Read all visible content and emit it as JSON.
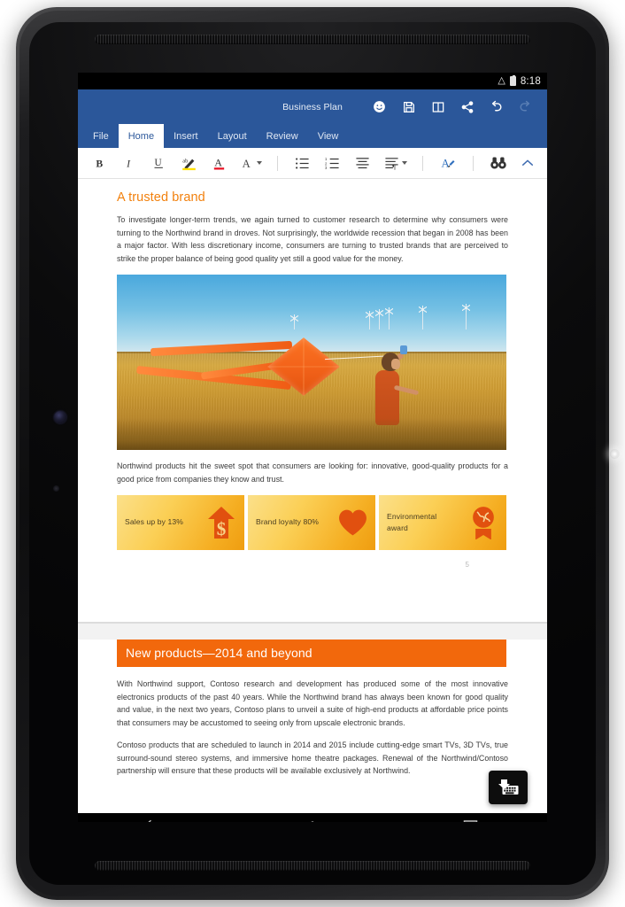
{
  "status_bar": {
    "wifi_icon": "wifi-icon",
    "battery_icon": "battery-full-icon",
    "clock": "8:18"
  },
  "title_bar": {
    "document_title": "Business Plan",
    "actions": [
      {
        "name": "smiley-feedback-icon",
        "label": "Smiley feedback"
      },
      {
        "name": "save-icon",
        "label": "Save"
      },
      {
        "name": "read-mode-icon",
        "label": "Read mode"
      },
      {
        "name": "share-icon",
        "label": "Share"
      },
      {
        "name": "undo-icon",
        "label": "Undo"
      },
      {
        "name": "redo-icon",
        "label": "Redo"
      }
    ]
  },
  "ribbon": {
    "tabs": [
      {
        "label": "File",
        "active": false
      },
      {
        "label": "Home",
        "active": true
      },
      {
        "label": "Insert",
        "active": false
      },
      {
        "label": "Layout",
        "active": false
      },
      {
        "label": "Review",
        "active": false
      },
      {
        "label": "View",
        "active": false
      }
    ],
    "toolbar": [
      {
        "name": "bold-icon",
        "label": "Bold"
      },
      {
        "name": "italic-icon",
        "label": "Italic"
      },
      {
        "name": "underline-icon",
        "label": "Underline"
      },
      {
        "name": "text-highlight-icon",
        "label": "Text Highlight Color"
      },
      {
        "name": "font-color-icon",
        "label": "Font Color"
      },
      {
        "name": "font-size-icon",
        "label": "Font Size"
      },
      {
        "name": "bullet-list-icon",
        "label": "Bulleted List"
      },
      {
        "name": "numbered-list-icon",
        "label": "Numbered List"
      },
      {
        "name": "align-icon",
        "label": "Alignment"
      },
      {
        "name": "paragraph-marks-icon",
        "label": "Paragraph Marks"
      },
      {
        "name": "format-painter-icon",
        "label": "Format Painter"
      },
      {
        "name": "find-icon",
        "label": "Find"
      }
    ],
    "collapse_icon": "chevron-up-icon"
  },
  "document": {
    "page5": {
      "heading": "A trusted brand",
      "paragraph1": "To investigate longer-term trends, we again turned to customer research to determine why consumers were turning to the Northwind brand in droves. Not surprisingly, the worldwide recession that began in 2008 has been a major factor. With less discretionary income, consumers are turning to trusted brands that are perceived to strike the proper balance of being good quality yet still a good value for the money.",
      "figure_alt": "Boy running through a wheat field flying an orange kite under a blue sky with wind turbines",
      "caption": "Northwind products hit the sweet spot that consumers are looking for: innovative, good-quality products for a good price from companies they know and trust.",
      "info_boxes": [
        {
          "label": "Sales up by 13%",
          "icon": "dollar-arrow-up-icon"
        },
        {
          "label": "Brand loyalty 80%",
          "icon": "heart-icon"
        },
        {
          "label": "Environmental award",
          "icon": "globe-award-icon"
        }
      ],
      "page_number": "5"
    },
    "page6": {
      "heading": "New products—2014 and beyond",
      "paragraph1": "With Northwind support, Contoso research and development has produced some of the most innovative electronics products of the past 40 years. While the Northwind brand has always been known for good quality and value, in the next two years, Contoso plans to unveil a suite of high-end products at affordable price points that consumers may be accustomed to seeing only from upscale electronic brands.",
      "paragraph2": "Contoso products that are scheduled to launch in 2014 and 2015 include cutting-edge smart TVs, 3D TVs, true surround-sound stereo systems, and immersive home theatre packages. Renewal of the Northwind/Contoso partnership will ensure that these products will be available exclusively at Northwind."
    }
  },
  "floating_button": {
    "icon": "keyboard-hide-icon",
    "label": "Hide keyboard"
  },
  "nav_bar": {
    "buttons": [
      {
        "name": "back-icon",
        "label": "Back"
      },
      {
        "name": "home-icon",
        "label": "Home"
      },
      {
        "name": "recents-icon",
        "label": "Recent apps"
      }
    ]
  },
  "colors": {
    "word_blue": "#2b579a",
    "accent_orange": "#f2680c",
    "heading_orange": "#f2800d",
    "info_box_gold": "#f5ae22"
  }
}
